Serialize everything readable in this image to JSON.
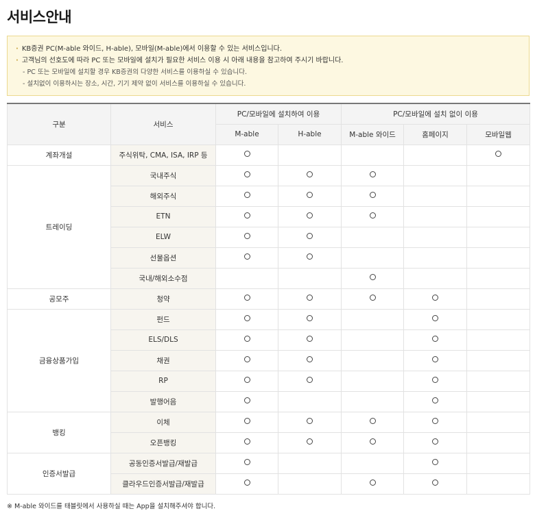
{
  "title": "서비스안내",
  "notice": {
    "lines": [
      "KB증권 PC(M-able 와이드, H-able), 모바일(M-able)에서 이용할 수 있는 서비스입니다.",
      "고객님의 선호도에 따라 PC 또는 모바일에 설치가 필요한 서비스 이용 시 아래 내용을 참고하여 주시기 바랍니다."
    ],
    "sub_lines": [
      "- PC 또는 모바일에 설치할 경우 KB증권의 다양한 서비스를 이용하실 수 있습니다.",
      "- 설치없이 이용하시는 장소, 시간, 기기 제약 없이 서비스를 이용하실 수 있습니다."
    ]
  },
  "table": {
    "header": {
      "category": "구분",
      "service": "서비스",
      "group_install": "PC/모바일에 설치하여 이용",
      "group_noinstall": "PC/모바일에 설치 없이 이용",
      "columns": [
        "M-able",
        "H-able",
        "M-able 와이드",
        "홈페이지",
        "모바일웹"
      ]
    },
    "mark_symbol": "○",
    "groups": [
      {
        "category": "계좌개설",
        "rows": [
          {
            "service": "주식위탁, CMA, ISA, IRP 등",
            "marks": [
              true,
              false,
              false,
              false,
              true
            ]
          }
        ]
      },
      {
        "category": "트레이딩",
        "rows": [
          {
            "service": "국내주식",
            "marks": [
              true,
              true,
              true,
              false,
              false
            ]
          },
          {
            "service": "해외주식",
            "marks": [
              true,
              true,
              true,
              false,
              false
            ]
          },
          {
            "service": "ETN",
            "marks": [
              true,
              true,
              true,
              false,
              false
            ]
          },
          {
            "service": "ELW",
            "marks": [
              true,
              true,
              false,
              false,
              false
            ]
          },
          {
            "service": "선물옵션",
            "marks": [
              true,
              true,
              false,
              false,
              false
            ]
          },
          {
            "service": "국내/해외소수점",
            "marks": [
              false,
              false,
              true,
              false,
              false
            ]
          }
        ]
      },
      {
        "category": "공모주",
        "rows": [
          {
            "service": "청약",
            "marks": [
              true,
              true,
              true,
              true,
              false
            ]
          }
        ]
      },
      {
        "category": "금융상품가입",
        "rows": [
          {
            "service": "펀드",
            "marks": [
              true,
              true,
              false,
              true,
              false
            ]
          },
          {
            "service": "ELS/DLS",
            "marks": [
              true,
              true,
              false,
              true,
              false
            ]
          },
          {
            "service": "채권",
            "marks": [
              true,
              true,
              false,
              true,
              false
            ]
          },
          {
            "service": "RP",
            "marks": [
              true,
              true,
              false,
              true,
              false
            ]
          },
          {
            "service": "발행어음",
            "marks": [
              true,
              false,
              false,
              true,
              false
            ]
          }
        ]
      },
      {
        "category": "뱅킹",
        "rows": [
          {
            "service": "이체",
            "marks": [
              true,
              true,
              true,
              true,
              false
            ]
          },
          {
            "service": "오픈뱅킹",
            "marks": [
              true,
              true,
              true,
              true,
              false
            ]
          }
        ]
      },
      {
        "category": "인증서발급",
        "rows": [
          {
            "service": "공동인증서발급/재발급",
            "marks": [
              true,
              false,
              false,
              true,
              false
            ]
          },
          {
            "service": "클라우드인증서발급/재발급",
            "marks": [
              true,
              false,
              true,
              true,
              false
            ]
          }
        ]
      }
    ]
  },
  "footnote": "※ M-able 와이드를 태블릿에서 사용하실 때는 App을 설치해주셔야 합니다."
}
